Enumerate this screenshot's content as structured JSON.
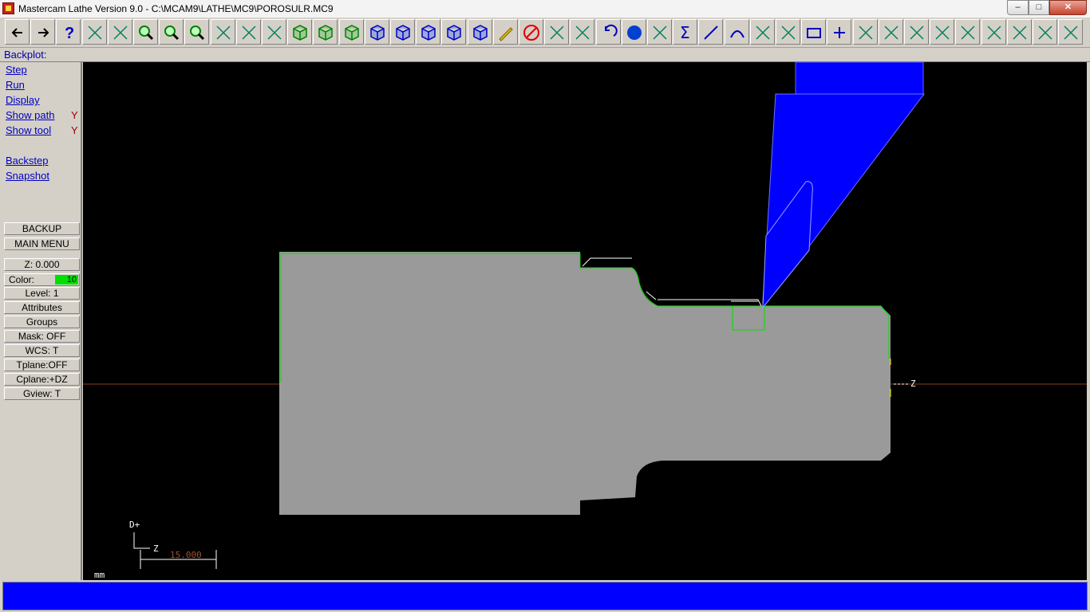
{
  "window": {
    "title": "Mastercam Lathe Version 9.0 - C:\\MCAM9\\LATHE\\MC9\\POROSULR.MC9",
    "min_label": "–",
    "max_label": "□",
    "close_label": "✕"
  },
  "toolbar": {
    "icons": [
      "back-arrow-icon",
      "forward-arrow-icon",
      "help-icon",
      "calculator-icon",
      "analyze-icon",
      "zoom-window-icon",
      "zoom-out-icon",
      "zoom-fit-icon",
      "pan-icon",
      "window-select-icon",
      "rotate-view-icon",
      "view-top-icon",
      "view-front-icon",
      "view-side-icon",
      "view-iso-icon",
      "cube-blue-1-icon",
      "cube-blue-2-icon",
      "cube-blue-3-icon",
      "cube-blue-4-icon",
      "pencil-icon",
      "delete-icon",
      "transform-icon",
      "xform-translate-icon",
      "undo-icon",
      "sphere-icon",
      "group-icon",
      "sigma-icon",
      "line-icon",
      "arc-icon",
      "fillet-icon",
      "spline-icon",
      "rectangle-icon",
      "point-plus-icon",
      "trim-icon",
      "break-icon",
      "divide-icon",
      "extend-icon",
      "modify-length-icon",
      "modify-endpoint-icon",
      "toolpath-icon",
      "backplot-icon",
      "pause-icon"
    ],
    "colors": {
      "accent_blue": "#0000ff",
      "accent_green": "#00a000"
    }
  },
  "menu": {
    "title": "Backplot:",
    "items": [
      {
        "label": "Step",
        "hotkey": "S"
      },
      {
        "label": "Run",
        "hotkey": "R"
      },
      {
        "label": "Display",
        "hotkey": "D"
      },
      {
        "label": "Show path",
        "hotkey": "p",
        "flag": "Y"
      },
      {
        "label": "Show tool",
        "hotkey": "t",
        "flag": "Y"
      },
      {
        "label": "Backstep",
        "hotkey": "B"
      },
      {
        "label": "Snapshot",
        "hotkey": "n"
      }
    ],
    "backup_label": "BACKUP",
    "main_menu_label": "MAIN MENU"
  },
  "status_panel": {
    "z": "Z:   0.000",
    "color_label": "Color:",
    "color_value": "10",
    "level": "Level:  1",
    "attributes": "Attributes",
    "groups": "Groups",
    "mask": "Mask:  OFF",
    "wcs": "WCS:   T",
    "tplane": "Tplane:OFF",
    "cplane": "Cplane:+DZ",
    "gview": "Gview:   T"
  },
  "viewport": {
    "axis_d_label": "D+",
    "axis_z_label": "Z",
    "scale_value": "15.000",
    "units": "mm",
    "origin_z_label": "Z",
    "colors": {
      "background": "#000000",
      "stock": "#9a9a9a",
      "toolpath": "#00e000",
      "tool": "#0000ff",
      "centerline": "#8b3a1a"
    }
  },
  "status_bar": {
    "prompt": ""
  }
}
